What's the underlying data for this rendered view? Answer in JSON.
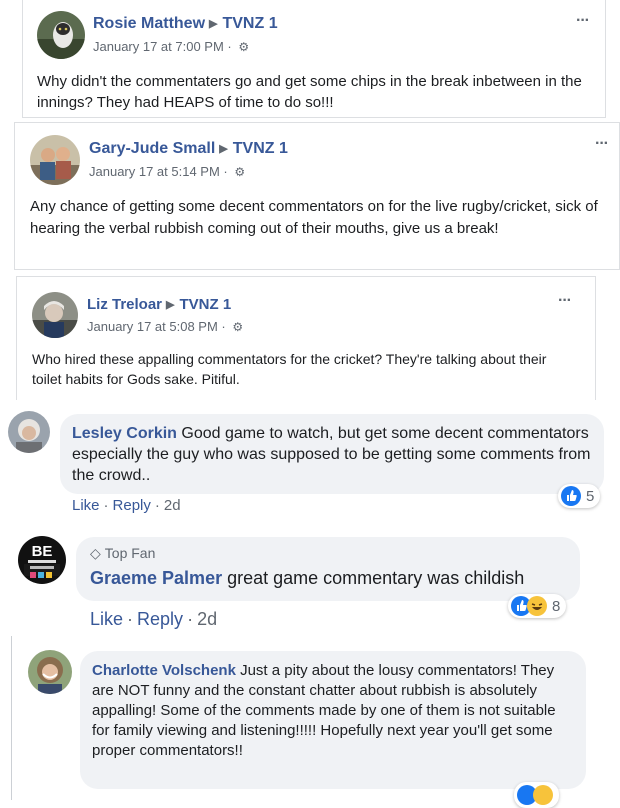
{
  "posts": [
    {
      "author": "Rosie Matthew",
      "page": "TVNZ 1",
      "time": "January 17 at 7:00 PM · ",
      "text": "Why didn't the commentaters go and get some chips in the break inbetween in the innings? They had HEAPS of time to do so!!!",
      "more": "···"
    },
    {
      "author": "Gary-Jude Small",
      "page": "TVNZ 1",
      "time": "January 17 at 5:14 PM · ",
      "text": "Any chance of getting some decent commentators on for the live rugby/cricket, sick of hearing the verbal rubbish coming out of their mouths, give us a break!",
      "more": "···"
    },
    {
      "author": "Liz Treloar",
      "page": "TVNZ 1",
      "time": "January 17 at 5:08 PM · ",
      "text": "Who hired these appalling commentators for the cricket? They're talking about their toilet habits for Gods sake. Pitiful.",
      "more": "···"
    }
  ],
  "comments": [
    {
      "author": "Lesley Corkin",
      "text": "Good game to watch, but get some decent commentators especially the guy who was supposed to be getting some comments from the crowd..",
      "like": "Like",
      "reply": "Reply",
      "age": "2d",
      "reaction_count": "5"
    },
    {
      "badge": "Top Fan",
      "author": "Graeme Palmer",
      "text": "great game commentary was childish",
      "like": "Like",
      "reply": "Reply",
      "age": "2d",
      "reaction_count": "8",
      "avatar_text": "BE"
    },
    {
      "author": "Charlotte Volschenk",
      "text": "Just a pity about the lousy commentators! They are NOT funny and the constant chatter about rubbish is absolutely appalling! Some of the comments made by one of them is not suitable for family viewing and listening!!!!! Hopefully next year you'll get some proper commentators!!"
    }
  ],
  "icons": {
    "separator": "▶",
    "globe": "⚙",
    "badge": "◇"
  },
  "colors": {
    "link": "#385898",
    "meta": "#606770",
    "bubble": "#f0f2f5",
    "like_blue": "#1877f2",
    "haha_yellow": "#f7c33b"
  }
}
